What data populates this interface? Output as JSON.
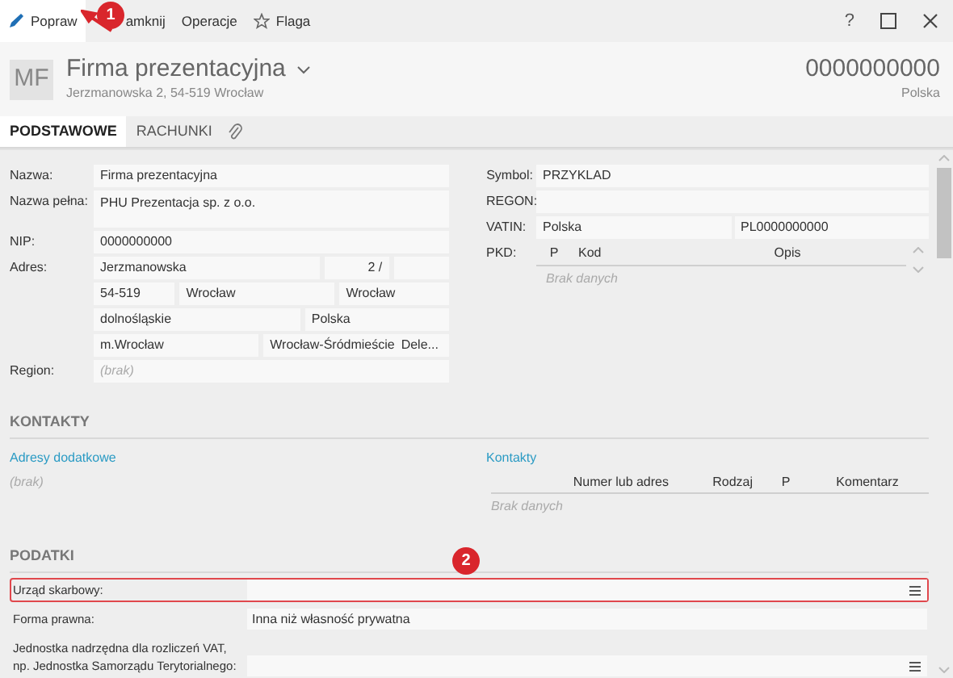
{
  "toolbar": {
    "actions": [
      {
        "label": "Popraw",
        "selected": true
      },
      {
        "label": "amknij",
        "selected": false
      },
      {
        "label": "Operacje",
        "selected": false
      },
      {
        "label": "Flaga",
        "selected": false
      }
    ],
    "help": "?"
  },
  "header": {
    "initials": "MF",
    "title": "Firma prezentacyjna",
    "address": "Jerzmanowska 2, 54-519 Wrocław",
    "number": "0000000000",
    "country": "Polska"
  },
  "tabs": [
    {
      "label": "PODSTAWOWE",
      "selected": true
    },
    {
      "label": "RACHUNKI",
      "selected": false
    }
  ],
  "left_fields": [
    {
      "label": "Nazwa:",
      "kind": "single",
      "value": "Firma prezentacyjna"
    },
    {
      "label": "Nazwa pełna:",
      "kind": "tall",
      "value": "PHU Prezentacja sp. z o.o."
    },
    {
      "label": "NIP:",
      "kind": "single",
      "value": "0000000000"
    },
    {
      "label": "Adres:",
      "kind": "grid",
      "lines": [
        {
          "parts": [
            "Jerzmanowska",
            "2 /"
          ]
        },
        {
          "parts": [
            "54-519",
            "Wrocław",
            "Wrocław"
          ]
        },
        {
          "parts": [
            "dolnośląskie",
            "Polska"
          ]
        },
        {
          "parts": [
            "m.Wrocław",
            "Wrocław-Śródmieście",
            "Dele..."
          ]
        }
      ]
    },
    {
      "label": "Region:",
      "kind": "single",
      "placeholder": "(brak)"
    }
  ],
  "right_fields": [
    {
      "label": "Symbol:",
      "kind": "single",
      "value": "PRZYKLAD"
    },
    {
      "label": "REGON:",
      "kind": "single"
    },
    {
      "label": "VATIN:",
      "kind": "pair",
      "values": [
        "Polska",
        "PL0000000000"
      ]
    },
    {
      "label": "PKD:",
      "kind": "table",
      "columns": [
        "P",
        "Kod",
        "Opis"
      ],
      "empty": "Brak danych"
    }
  ],
  "contacts": {
    "title": "KONTAKTY",
    "addresses": {
      "link": "Adresy dodatkowe",
      "empty": "(brak)"
    },
    "list": {
      "link": "Kontakty",
      "columns": [
        "Numer lub adres",
        "Rodzaj",
        "P",
        "Komentarz"
      ],
      "empty": "Brak danych"
    }
  },
  "taxes": {
    "title": "PODATKI",
    "rows": [
      {
        "label": "Urząd skarbowy:",
        "picker": true,
        "highlighted": true
      },
      {
        "label": "Forma prawna:",
        "value": "Inna niż własność prywatna",
        "picker": false,
        "highlighted": false
      },
      {
        "label": "Jednostka nadrzędna dla rozliczeń VAT,\nnp. Jednostka Samorządu Terytorialnego:",
        "picker": true,
        "highlighted": false
      }
    ]
  },
  "annotations": [
    "1",
    "2"
  ]
}
